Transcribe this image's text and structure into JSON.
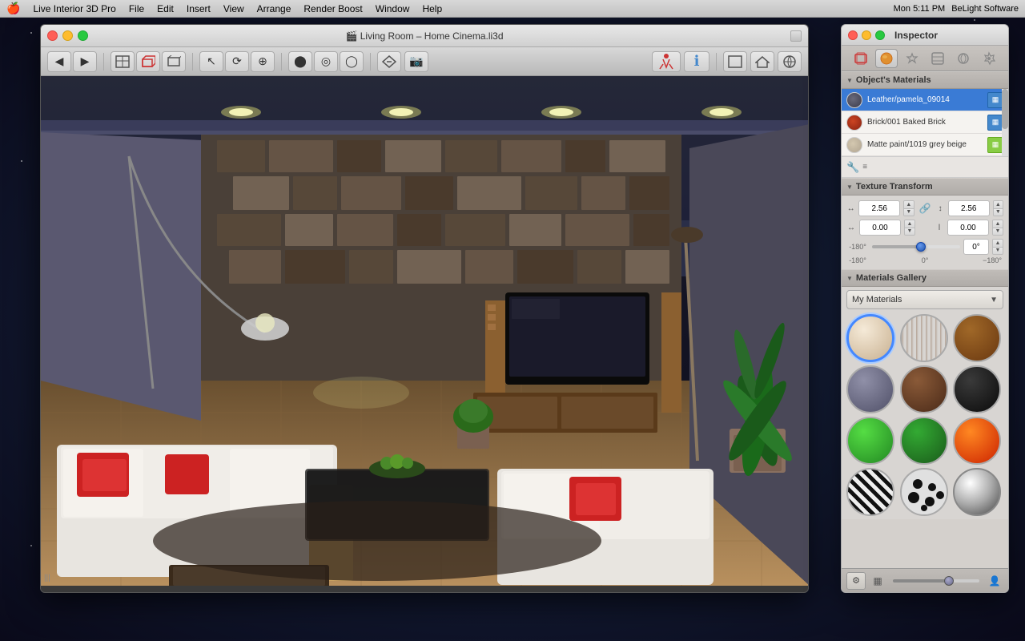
{
  "menubar": {
    "apple": "🍎",
    "items": [
      "Live Interior 3D Pro",
      "File",
      "Edit",
      "Insert",
      "View",
      "Arrange",
      "Render Boost",
      "Window",
      "Help"
    ],
    "right": {
      "time": "Mon 5:11 PM",
      "app": "BeLight Software"
    }
  },
  "window": {
    "title": "🎬 Living Room – Home Cinema.li3d",
    "traffic": [
      "close",
      "minimize",
      "maximize"
    ]
  },
  "inspector": {
    "title": "Inspector",
    "section_materials": "Object's Materials",
    "materials": [
      {
        "name": "Leather/pamela_09014",
        "swatch": "leather",
        "iconType": "blue"
      },
      {
        "name": "Brick/001 Baked Brick",
        "swatch": "brick",
        "iconType": "blue"
      },
      {
        "name": "Matte paint/1019 grey beige",
        "swatch": "matte",
        "iconType": "green"
      }
    ],
    "texture_transform": {
      "label": "Texture Transform",
      "h1_val": "2.56",
      "w1_val": "2.56",
      "h2_val": "0.00",
      "w2_val": "0.00",
      "angle_val": "0°",
      "slider_min": "-180°",
      "slider_mid": "0°",
      "slider_max": "−180°"
    },
    "gallery": {
      "label": "Materials Gallery",
      "dropdown_selected": "My Materials",
      "balls": [
        {
          "id": "cream",
          "class": "mb-cream",
          "selected": true
        },
        {
          "id": "wood1",
          "class": "mb-wood1",
          "selected": false
        },
        {
          "id": "wood2",
          "class": "mb-wood2",
          "selected": false
        },
        {
          "id": "marble",
          "class": "mb-marble",
          "selected": false
        },
        {
          "id": "brown",
          "class": "mb-brown",
          "selected": false
        },
        {
          "id": "dark",
          "class": "mb-dark",
          "selected": false
        },
        {
          "id": "green-bright",
          "class": "mb-green-bright",
          "selected": false
        },
        {
          "id": "green-med",
          "class": "mb-green-med",
          "selected": false
        },
        {
          "id": "fire",
          "class": "mb-fire",
          "selected": false
        },
        {
          "id": "zebra",
          "class": "mb-zebra",
          "selected": false
        },
        {
          "id": "spots",
          "class": "mb-spots",
          "selected": false
        },
        {
          "id": "chrome",
          "class": "mb-chrome",
          "selected": false
        }
      ]
    }
  }
}
